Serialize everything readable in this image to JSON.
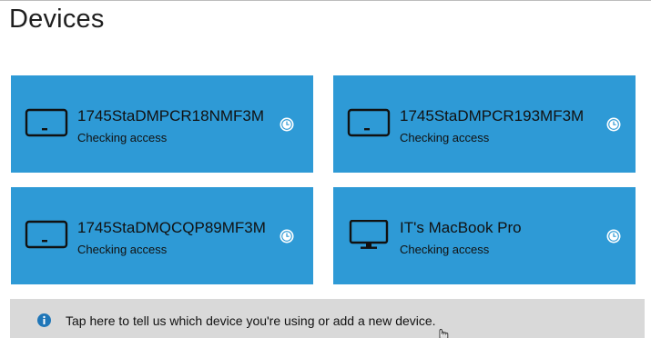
{
  "page": {
    "title": "Devices"
  },
  "devices": [
    {
      "name": "1745StaDMPCR18NMF3M",
      "status": "Checking access",
      "icon": "laptop-icon",
      "status_icon": "clock-icon"
    },
    {
      "name": "1745StaDMPCR193MF3M",
      "status": "Checking access",
      "icon": "laptop-icon",
      "status_icon": "clock-icon"
    },
    {
      "name": "1745StaDMQCQP89MF3M",
      "status": "Checking access",
      "icon": "laptop-icon",
      "status_icon": "clock-icon"
    },
    {
      "name": "IT's MacBook Pro",
      "status": "Checking access",
      "icon": "desktop-icon",
      "status_icon": "clock-icon"
    }
  ],
  "banner": {
    "text": "Tap here to tell us which device you're using or add a new device.",
    "icon": "info-icon"
  },
  "colors": {
    "tile": "#2e9ad6",
    "banner": "#d9d9d9",
    "info_icon": "#1f76b8"
  }
}
